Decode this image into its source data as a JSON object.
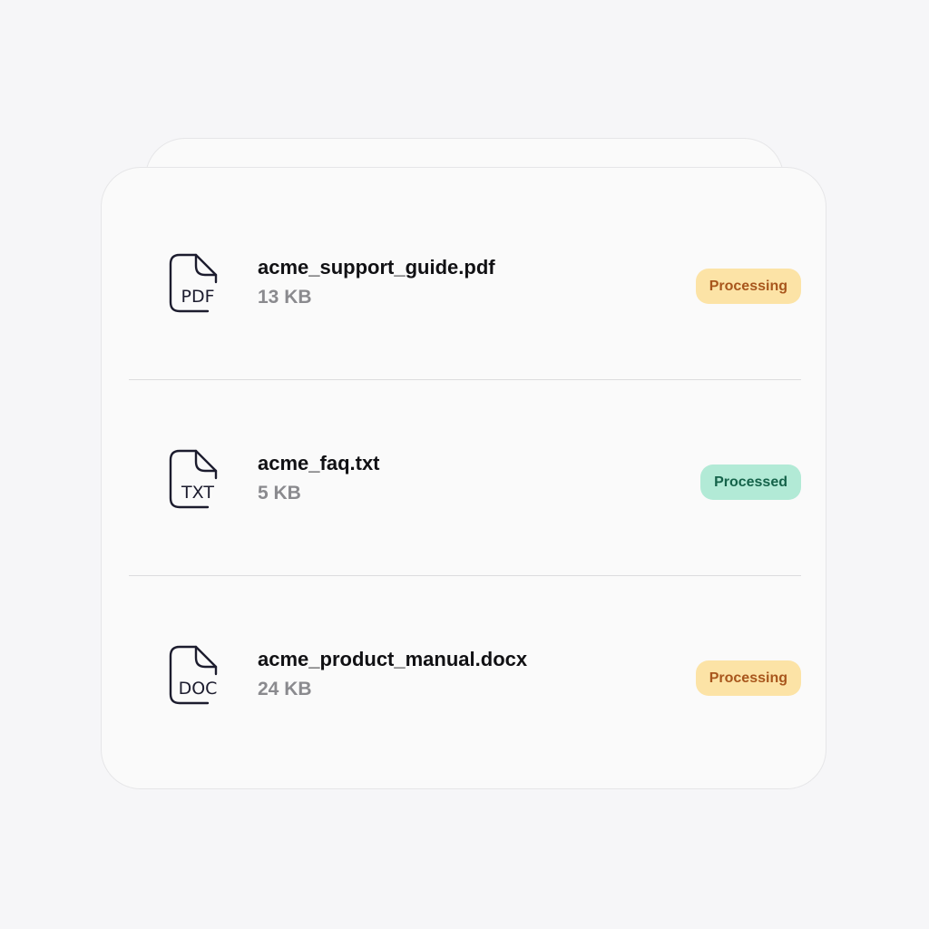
{
  "colors": {
    "background": "#f6f6f8",
    "card": "#fafafa",
    "icon_stroke": "#1c1c2e",
    "processing_bg": "#fce3a6",
    "processing_text": "#a8561c",
    "processed_bg": "#b2ead6",
    "processed_text": "#15634a"
  },
  "files": [
    {
      "icon": "pdf-file-icon",
      "type_label": "PDF",
      "name": "acme_support_guide.pdf",
      "size": "13 KB",
      "status": "Processing",
      "status_kind": "processing"
    },
    {
      "icon": "txt-file-icon",
      "type_label": "TXT",
      "name": "acme_faq.txt",
      "size": "5 KB",
      "status": "Processed",
      "status_kind": "processed"
    },
    {
      "icon": "doc-file-icon",
      "type_label": "DOC",
      "name": "acme_product_manual.docx",
      "size": "24 KB",
      "status": "Processing",
      "status_kind": "processing"
    }
  ]
}
